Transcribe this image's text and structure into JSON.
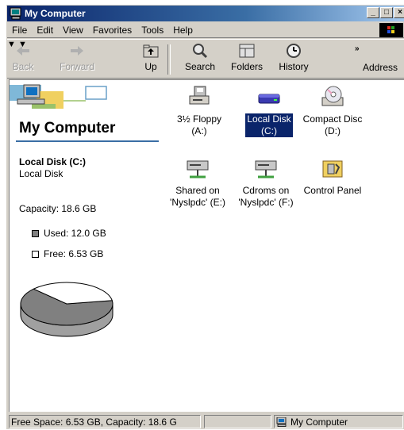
{
  "window": {
    "title": "My Computer",
    "controls": [
      "_",
      "□",
      "×"
    ]
  },
  "menu": {
    "items": [
      "File",
      "Edit",
      "View",
      "Favorites",
      "Tools",
      "Help"
    ]
  },
  "toolbar": {
    "back": "Back",
    "forward": "Forward",
    "up": "Up",
    "search": "Search",
    "folders": "Folders",
    "history": "History",
    "more": "»",
    "address": "Address"
  },
  "left": {
    "heading": "My Computer",
    "selected_name": "Local Disk (C:)",
    "selected_type": "Local Disk",
    "capacity": "Capacity: 18.6 GB",
    "used": "Used: 12.0 GB",
    "free": "Free: 6.53 GB"
  },
  "disk_usage": {
    "used_gb": 12.0,
    "free_gb": 6.53,
    "used_color": "#808080",
    "free_color": "#ffffff"
  },
  "items": [
    {
      "name": "3½ Floppy",
      "sub": "(A:)",
      "icon": "floppy-drive-icon"
    },
    {
      "name": "Local Disk",
      "sub": "(C:)",
      "icon": "hard-disk-icon",
      "selected": true
    },
    {
      "name": "Compact Disc",
      "sub": "(D:)",
      "icon": "cd-drive-icon"
    },
    {
      "name": "Shared on",
      "sub": "'Nyslpdc' (E:)",
      "icon": "network-drive-icon"
    },
    {
      "name": "Cdroms on",
      "sub": "'Nyslpdc' (F:)",
      "icon": "network-drive-icon"
    },
    {
      "name": "Control Panel",
      "sub": "",
      "icon": "control-panel-icon"
    }
  ],
  "status": {
    "left": "Free Space: 6.53 GB, Capacity: 18.6 G",
    "right": "My Computer"
  }
}
